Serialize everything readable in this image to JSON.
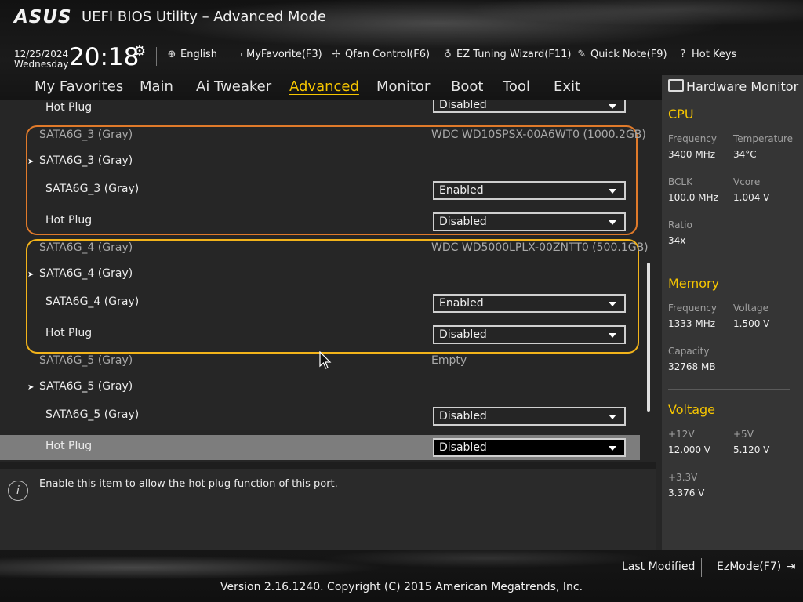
{
  "header": {
    "logo": "ASUS",
    "title": "UEFI BIOS Utility – Advanced Mode",
    "date": "12/25/2024",
    "weekday": "Wednesday",
    "time": "20:18",
    "buttons": [
      {
        "label": "English",
        "icon": "globe-icon"
      },
      {
        "label": "MyFavorite(F3)",
        "icon": "favorite-folder-icon"
      },
      {
        "label": "Qfan Control(F6)",
        "icon": "fan-icon"
      },
      {
        "label": "EZ Tuning Wizard(F11)",
        "icon": "lightbulb-icon"
      },
      {
        "label": "Quick Note(F9)",
        "icon": "note-icon"
      },
      {
        "label": "Hot Keys",
        "icon": "question-key-icon"
      }
    ]
  },
  "tabs": [
    "My Favorites",
    "Main",
    "Ai Tweaker",
    "Advanced",
    "Monitor",
    "Boot",
    "Tool",
    "Exit"
  ],
  "active_tab": "Advanced",
  "settings": {
    "top_hotplug": {
      "label": "Hot Plug",
      "value": "Disabled"
    },
    "ports": [
      {
        "header": "SATA6G_3 (Gray)",
        "device": "WDC WD10SPSX-00A6WT0 (1000.2GB)",
        "submenu": "SATA6G_3 (Gray)",
        "port_label": "SATA6G_3 (Gray)",
        "port_value": "Enabled",
        "hotplug_label": "Hot Plug",
        "hotplug_value": "Disabled"
      },
      {
        "header": "SATA6G_4 (Gray)",
        "device": "WDC WD5000LPLX-00ZNTT0 (500.1GB)",
        "submenu": "SATA6G_4 (Gray)",
        "port_label": "SATA6G_4 (Gray)",
        "port_value": "Enabled",
        "hotplug_label": "Hot Plug",
        "hotplug_value": "Disabled"
      },
      {
        "header": "SATA6G_5 (Gray)",
        "device": "Empty",
        "submenu": "SATA6G_5 (Gray)",
        "port_label": "SATA6G_5 (Gray)",
        "port_value": "Disabled",
        "hotplug_label": "Hot Plug",
        "hotplug_value": "Disabled"
      }
    ],
    "box_colors": {
      "sata3": "#e07a2a",
      "sata4": "#f2b31a"
    }
  },
  "help": {
    "text": "Enable this item to allow the hot plug function of this port."
  },
  "hardware_monitor": {
    "title": "Hardware Monitor",
    "cpu": {
      "heading": "CPU",
      "frequency_label": "Frequency",
      "frequency": "3400 MHz",
      "temperature_label": "Temperature",
      "temperature": "34°C",
      "bclk_label": "BCLK",
      "bclk": "100.0 MHz",
      "vcore_label": "Vcore",
      "vcore": "1.004 V",
      "ratio_label": "Ratio",
      "ratio": "34x"
    },
    "memory": {
      "heading": "Memory",
      "frequency_label": "Frequency",
      "frequency": "1333 MHz",
      "voltage_label": "Voltage",
      "voltage": "1.500 V",
      "capacity_label": "Capacity",
      "capacity": "32768 MB"
    },
    "voltage": {
      "heading": "Voltage",
      "v12_label": "+12V",
      "v12": "12.000 V",
      "v5_label": "+5V",
      "v5": "5.120 V",
      "v33_label": "+3.3V",
      "v33": "3.376 V"
    }
  },
  "footer": {
    "last_modified": "Last Modified",
    "ezmode": "EzMode(F7)",
    "copyright": "Version 2.16.1240. Copyright (C) 2015 American Megatrends, Inc."
  },
  "colors": {
    "accent": "#f7c600",
    "highlight_row": "#7d7d7d"
  }
}
